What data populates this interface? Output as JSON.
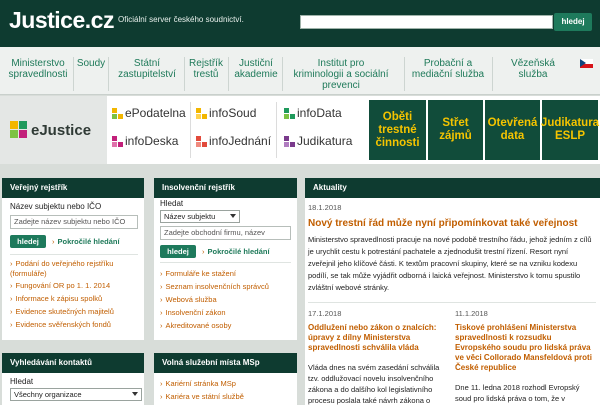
{
  "header": {
    "logo": "Justice.cz",
    "tagline": "Oficiální server českého soudnictví.",
    "search_placeholder": "",
    "search_button": "hledej"
  },
  "nav": [
    {
      "label": "Ministerstvo\nspravedlnosti"
    },
    {
      "label": "Soudy"
    },
    {
      "label": "Státní\nzastupitelství"
    },
    {
      "label": "Rejstřík\ntrestů"
    },
    {
      "label": "Justiční\nakademie"
    },
    {
      "label": "Institut pro\nkriminologii a sociální\nprevenci"
    },
    {
      "label": "Probační a\nmediační služba"
    },
    {
      "label": "Vězeňská služba"
    }
  ],
  "logos": {
    "ejustice": "eJustice",
    "epodatelna": "ePodatelna",
    "infosoud": "infoSoud",
    "infodata": "infoData",
    "infodeska": "infoDeska",
    "infojednani": "infoJednání",
    "judikatura": "Judikatura",
    "tiles": [
      "Oběti\ntrestné\nčinnosti",
      "Střet\nzájmů",
      "Otevřená\ndata",
      "Judikatura\nESLP"
    ]
  },
  "verejny": {
    "title": "Veřejný rejstřík",
    "field_label": "Název subjektu nebo IČO",
    "input_placeholder": "Zadejte název subjektu nebo IČO",
    "button": "hledej",
    "advanced": "Pokročilé hledání",
    "links": [
      "Podání do veřejného rejstříku (formuláře)",
      "Fungování OR po 1. 1. 2014",
      "Informace k zápisu spolků",
      "Evidence skutečných majitelů",
      "Evidence svěřenských fondů"
    ]
  },
  "insolvencni": {
    "title": "Insolvenční rejstřík",
    "field_label": "Hledat",
    "select_value": "Název subjektu",
    "input_placeholder": "Zadejte obchodní firmu, název",
    "button": "hledej",
    "advanced": "Pokročilé hledání",
    "links": [
      "Formuláře ke stažení",
      "Seznam insolvenčních správců",
      "Webová služba",
      "Insolvenční zákon",
      "Akreditované osoby"
    ]
  },
  "vyhledavani": {
    "title": "Vyhledávání kontaktů",
    "field_label": "Hledat",
    "select_value": "Všechny organizace"
  },
  "volna": {
    "title": "Volná služební místa MSp",
    "links": [
      "Kariérní stránka MSp",
      "Kariéra ve státní službě"
    ]
  },
  "aktuality": {
    "title": "Aktuality",
    "lead": {
      "date": "18.1.2018",
      "title": "Nový trestní řád může nyní připomínkovat také veřejnost",
      "text": "Ministerstvo spravedlnosti pracuje na nové podobě trestního řádu, jehož jedním z cílů je urychlit cestu k potrestání pachatele a zjednodušit trestní řízení. Resort nyní zveřejnil jeho klíčové části. K textům pracovní skupiny, které se na vzniku kodexu podílí, se tak může vyjádřit odborná i laická veřejnost. Ministerstvo k tomu spustilo zvláštní webové stránky."
    },
    "items": [
      {
        "date": "17.1.2018",
        "title": "Oddlužení nebo zákon o znalcích: úpravy z dílny Ministerstva spravedlnosti schválila vláda",
        "text": "Vláda dnes na svém zasedání schválila tzv. oddlužovací novelu insolvenčního zákona a do dalšího kol legislativního procesu poslala také návrh zákona o"
      },
      {
        "date": "11.1.2018",
        "title": "Tiskové prohlášení Ministerstva spravedlnosti k rozsudku Evropského soudu pro lidská práva ve věci Collorado Mansfeldová proti České republice",
        "text": "Dne 11. ledna 2018 rozhodl Evropský soud pro lidská práva o tom, že v"
      }
    ]
  },
  "colors": {
    "dark_green": "#0e3b30",
    "accent_green": "#1e7a5c",
    "link_green": "#1f7a5a",
    "orange": "#c15e00",
    "tile_yellow": "#f5c400"
  }
}
